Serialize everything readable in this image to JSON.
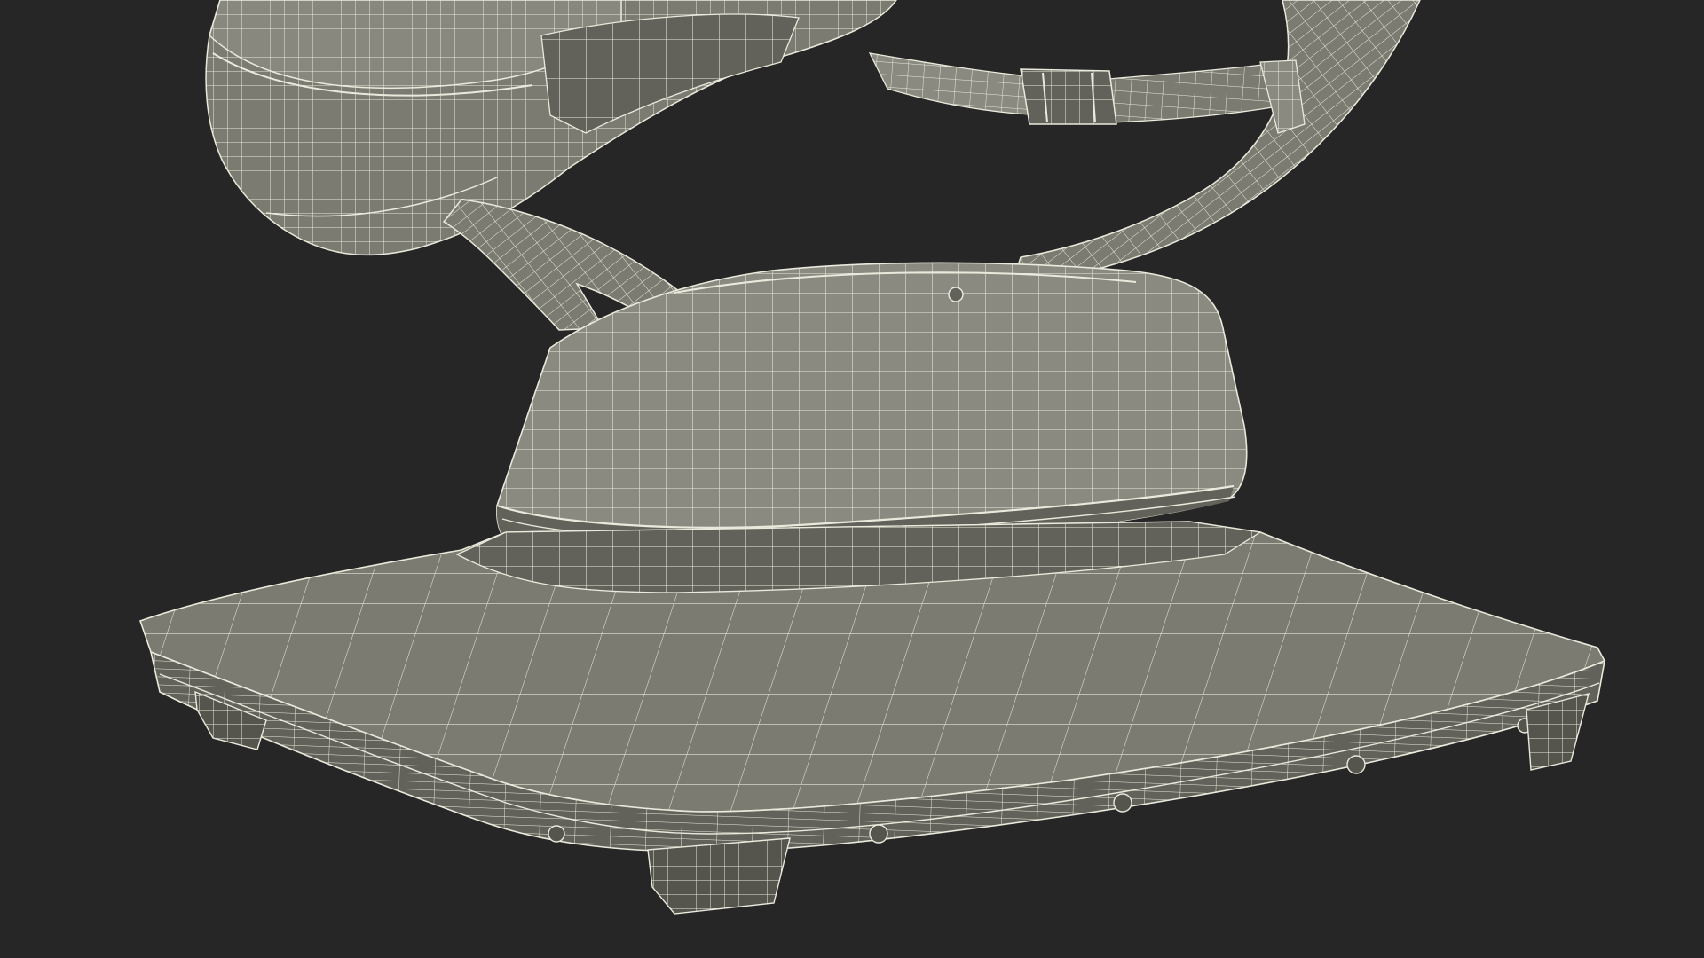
{
  "scene": {
    "colors": {
      "background": "#262626",
      "surface": "#7b7b71",
      "surface_light": "#8a8a80",
      "surface_dark": "#62625a",
      "surface_shadow": "#55554e",
      "wire": "#e9e9dc"
    }
  }
}
